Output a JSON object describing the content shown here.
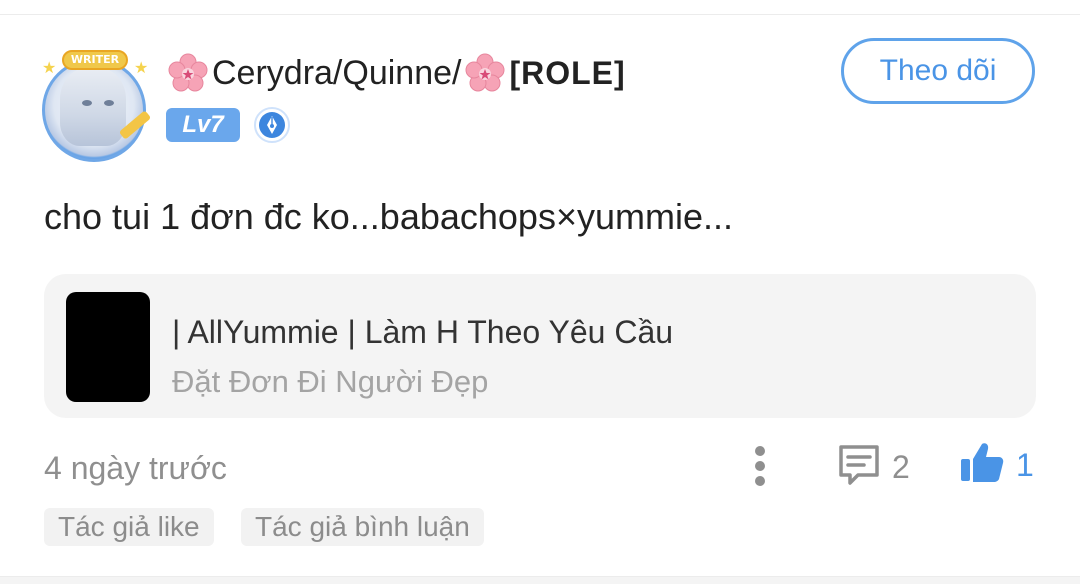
{
  "author": {
    "avatar_badge": "WRITER",
    "name_prefix_icon": "cherry-blossom-icon",
    "name": "Cerydra/Quinne/",
    "name_suffix_icon": "cherry-blossom-icon",
    "role": "[ROLE]",
    "level": "Lv7",
    "follow_label": "Theo dõi"
  },
  "post": {
    "text": "cho tui 1 đơn đc ko...babachops×yummie...",
    "story": {
      "title": "| AllYummie | Làm H Theo Yêu Cầu",
      "subtitle": "Đặt Đơn Đi Người Đẹp"
    },
    "timestamp": "4 ngày trước",
    "comment_count": "2",
    "like_count": "1"
  },
  "tags": {
    "author_like": "Tác giả like",
    "author_comment": "Tác giả bình luận"
  },
  "colors": {
    "accent": "#4a94e6",
    "level_badge": "#6aa7ec",
    "muted_text": "#8f8f8f",
    "card_bg": "#f4f4f4"
  }
}
